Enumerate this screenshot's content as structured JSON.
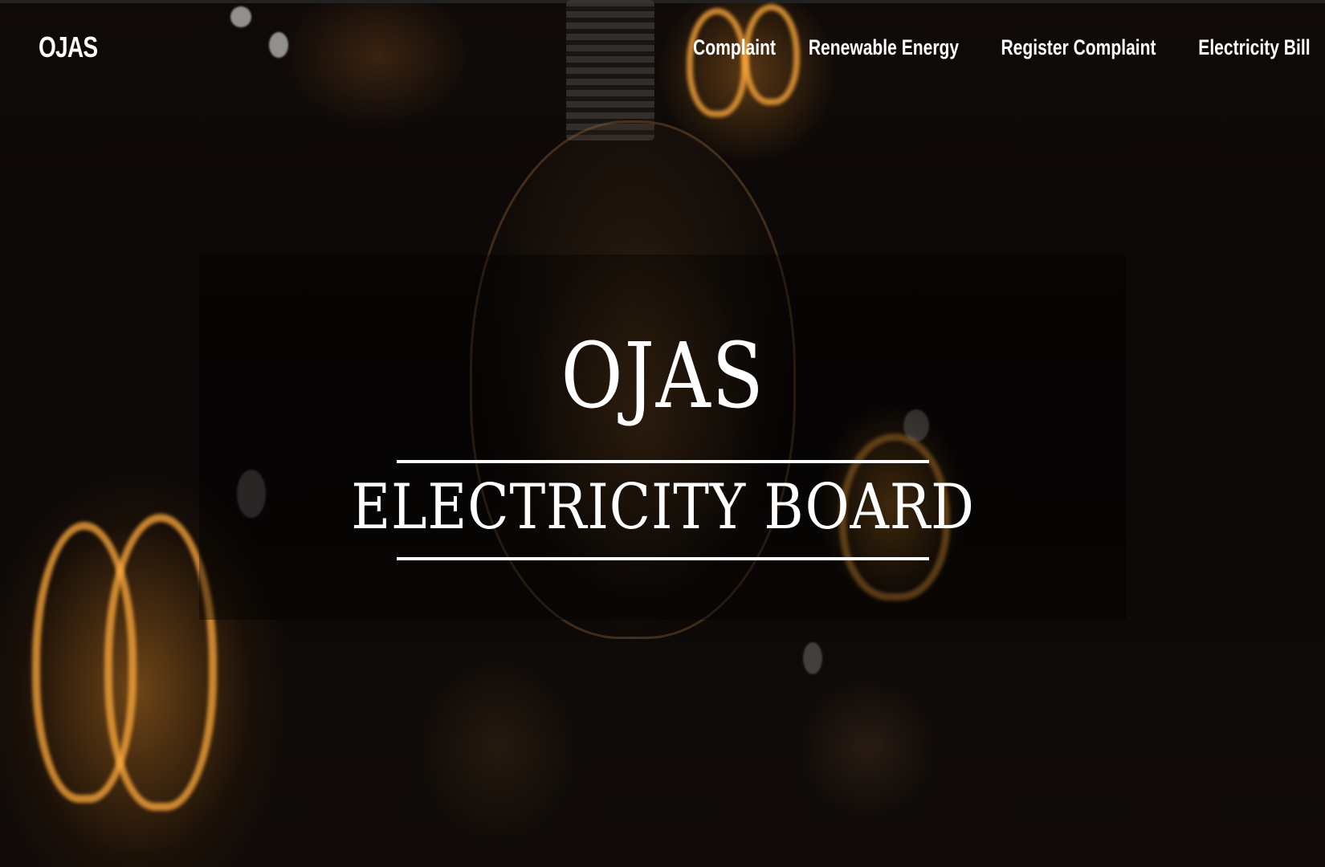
{
  "nav": {
    "brand": "OJAS",
    "links": [
      {
        "label": "Complaint"
      },
      {
        "label": "Renewable Energy"
      },
      {
        "label": "Register Complaint"
      },
      {
        "label": "Electricity Bill"
      }
    ]
  },
  "hero": {
    "title": "OJAS",
    "subtitle": "ELECTRICITY BOARD"
  },
  "background": {
    "image": "dark background photo of glowing vintage light bulbs",
    "accent_color": "#e8962e"
  }
}
